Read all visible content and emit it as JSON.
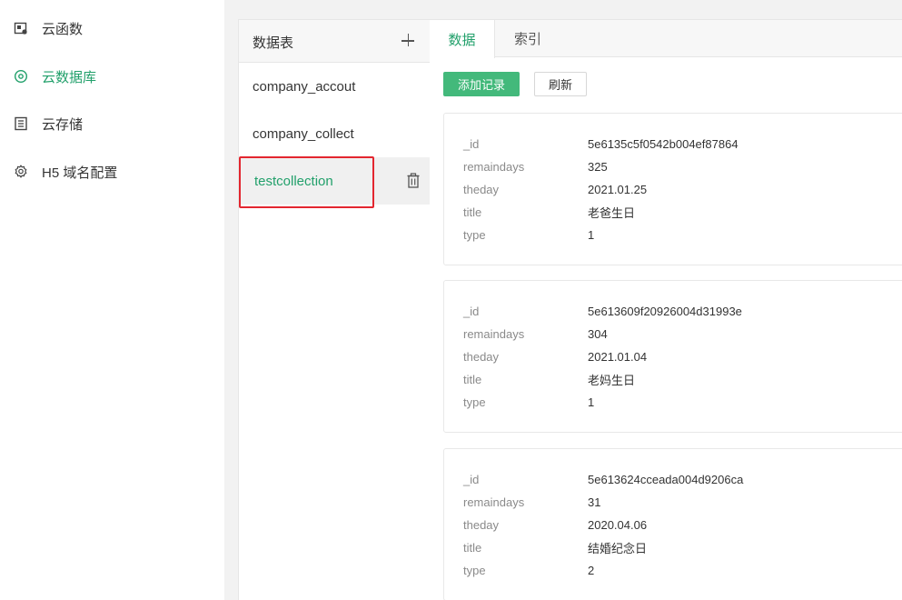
{
  "nav": {
    "items": [
      {
        "label": "云函数",
        "icon": "cloud-function-icon"
      },
      {
        "label": "云数据库",
        "icon": "cloud-database-icon",
        "active": true
      },
      {
        "label": "云存储",
        "icon": "cloud-storage-icon"
      },
      {
        "label": "H5 域名配置",
        "icon": "settings-icon"
      }
    ]
  },
  "collections": {
    "title": "数据表",
    "items": [
      {
        "name": "company_accout"
      },
      {
        "name": "company_collect"
      },
      {
        "name": "testcollection",
        "active": true
      }
    ]
  },
  "main": {
    "tabs": [
      {
        "label": "数据",
        "active": true
      },
      {
        "label": "索引"
      }
    ],
    "add_button": "添加记录",
    "refresh_button": "刷新",
    "records": [
      {
        "fields": [
          {
            "key": "_id",
            "value": "5e6135c5f0542b004ef87864"
          },
          {
            "key": "remaindays",
            "value": "325"
          },
          {
            "key": "theday",
            "value": "2021.01.25"
          },
          {
            "key": "title",
            "value": "老爸生日"
          },
          {
            "key": "type",
            "value": "1"
          }
        ]
      },
      {
        "fields": [
          {
            "key": "_id",
            "value": "5e613609f20926004d31993e"
          },
          {
            "key": "remaindays",
            "value": "304"
          },
          {
            "key": "theday",
            "value": "2021.01.04"
          },
          {
            "key": "title",
            "value": "老妈生日"
          },
          {
            "key": "type",
            "value": "1"
          }
        ]
      },
      {
        "fields": [
          {
            "key": "_id",
            "value": "5e613624cceada004d9206ca"
          },
          {
            "key": "remaindays",
            "value": "31"
          },
          {
            "key": "theday",
            "value": "2020.04.06"
          },
          {
            "key": "title",
            "value": "结婚纪念日"
          },
          {
            "key": "type",
            "value": "2"
          }
        ]
      }
    ]
  },
  "colors": {
    "accent": "#22a06b",
    "primary_button": "#43b97b",
    "highlight_box": "#e3262f"
  }
}
